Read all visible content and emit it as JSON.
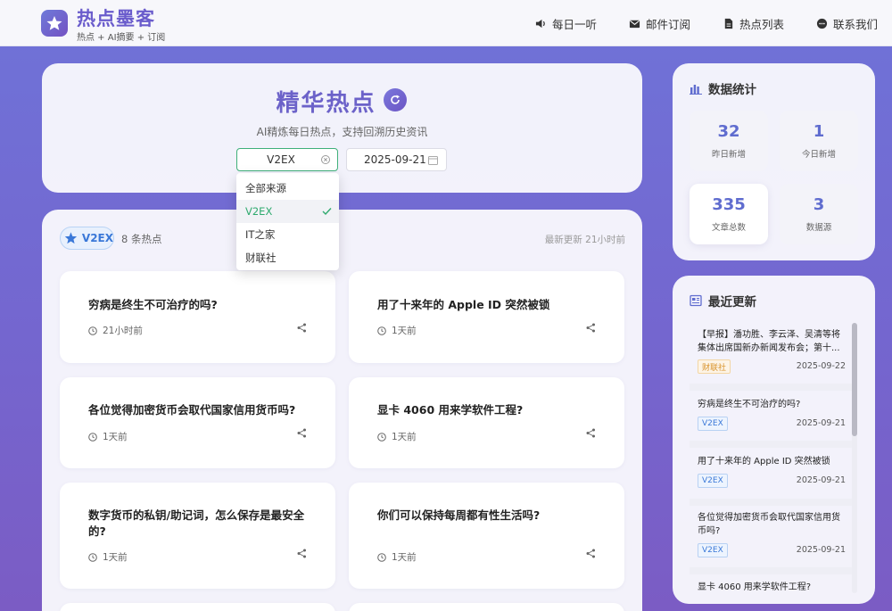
{
  "header": {
    "title": "热点墨客",
    "subtitle": "热点 + AI摘要 + 订阅",
    "nav": [
      {
        "label": "每日一听",
        "icon": "speaker-icon"
      },
      {
        "label": "邮件订阅",
        "icon": "mail-icon"
      },
      {
        "label": "热点列表",
        "icon": "document-icon"
      },
      {
        "label": "联系我们",
        "icon": "chat-icon"
      }
    ]
  },
  "hero": {
    "title": "精华热点",
    "subtitle": "AI精炼每日热点，支持回溯历史资讯",
    "source_value": "V2EX",
    "date_value": "2025-09-21"
  },
  "dropdown": {
    "options": [
      "全部来源",
      "V2EX",
      "IT之家",
      "财联社"
    ],
    "selected": "V2EX"
  },
  "main": {
    "badge": "V2EX",
    "count": "8 条热点",
    "updated": "最新更新 21小时前",
    "cards": [
      {
        "title": "穷病是终生不可治疗的吗?",
        "time": "21小时前"
      },
      {
        "title": "用了十来年的 Apple ID 突然被锁",
        "time": "1天前"
      },
      {
        "title": "各位觉得加密货币会取代国家信用货币吗?",
        "time": "1天前"
      },
      {
        "title": "显卡 4060 用来学软件工程?",
        "time": "1天前"
      },
      {
        "title": "数字货币的私钥/助记词，怎么保存是最安全的?",
        "time": "1天前"
      },
      {
        "title": "你们可以保持每周都有性生活吗?",
        "time": "1天前"
      }
    ]
  },
  "stats": {
    "title": "数据统计",
    "items": [
      {
        "value": "32",
        "label": "昨日新增"
      },
      {
        "value": "1",
        "label": "今日新增"
      },
      {
        "value": "335",
        "label": "文章总数"
      },
      {
        "value": "3",
        "label": "数据源"
      }
    ]
  },
  "recent": {
    "title": "最近更新",
    "items": [
      {
        "title": "【早报】潘功胜、李云泽、吴清等将集体出席国新办新闻发布会；第十...",
        "tag": "财联社",
        "date": "2025-09-22"
      },
      {
        "title": "穷病是终生不可治疗的吗?",
        "tag": "V2EX",
        "date": "2025-09-21"
      },
      {
        "title": "用了十来年的 Apple ID 突然被锁",
        "tag": "V2EX",
        "date": "2025-09-21"
      },
      {
        "title": "各位觉得加密货币会取代国家信用货币吗?",
        "tag": "V2EX",
        "date": "2025-09-21"
      },
      {
        "title": "显卡 4060 用来学软件工程?",
        "tag": "V2EX",
        "date": "2025-09-21"
      }
    ]
  },
  "colors": {
    "accent": "#6c62c9",
    "select_border": "#3fb07a",
    "tag_blue": "#3a78d8",
    "tag_orange": "#d8922a"
  }
}
